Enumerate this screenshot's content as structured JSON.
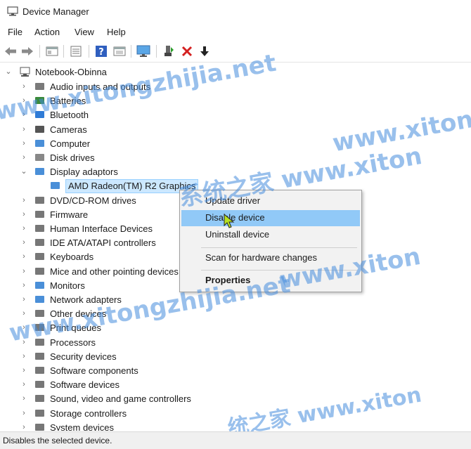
{
  "window": {
    "title": "Device Manager"
  },
  "menu": [
    "File",
    "Action",
    "View",
    "Help"
  ],
  "toolbar": {
    "buttons": [
      "back-arrow-icon",
      "forward-arrow-icon",
      "properties-icon",
      "list-icon",
      "help-icon",
      "scan-icon",
      "monitor-icon",
      "enable-device-icon",
      "uninstall-x-icon",
      "update-driver-icon"
    ]
  },
  "tree": {
    "root": "Notebook-Obinna",
    "categories": [
      "Audio inputs and outputs",
      "Batteries",
      "Bluetooth",
      "Cameras",
      "Computer",
      "Disk drives",
      "Display adaptors",
      "AMD Radeon(TM) R2 Graphics",
      "DVD/CD-ROM drives",
      "Firmware",
      "Human Interface Devices",
      "IDE ATA/ATAPI controllers",
      "Keyboards",
      "Mice and other pointing devices",
      "Monitors",
      "Network adapters",
      "Other devices",
      "Print queues",
      "Processors",
      "Security devices",
      "Software components",
      "Software devices",
      "Sound, video and game controllers",
      "Storage controllers",
      "System devices"
    ]
  },
  "context_menu": {
    "items": [
      "Update driver",
      "Disable device",
      "Uninstall device",
      "Scan for hardware changes",
      "Properties"
    ],
    "highlighted": "Disable device"
  },
  "status": {
    "text": "Disables the selected device."
  },
  "watermark": {
    "texts": [
      "www.xitongzhijia.net",
      "系统之家 www.xiton",
      "系统之家 www.xitongzhijia.net",
      "www.xitongzhijia.net",
      "www.xiton",
      "统之家 www.xiton"
    ]
  },
  "colors": {
    "selection": "#cce8ff",
    "menu_highlight": "#91c9f7",
    "watermark": "#468cdc"
  }
}
